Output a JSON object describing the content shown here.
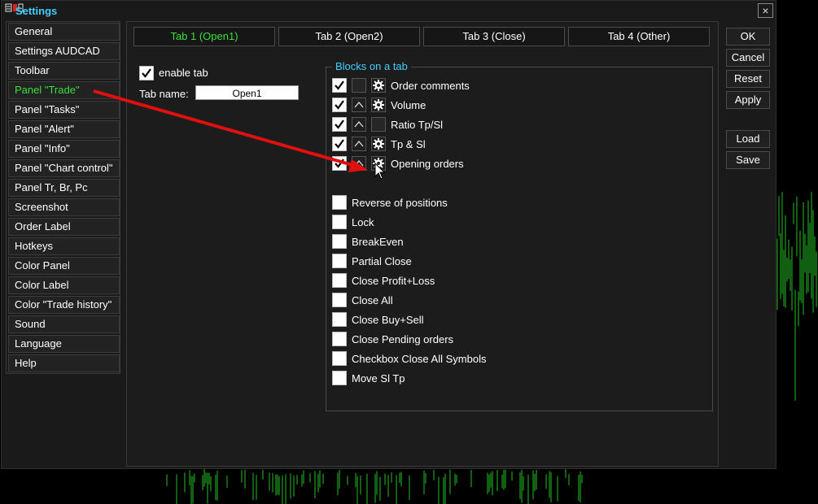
{
  "window": {
    "title": "Settings",
    "close_symbol": "×"
  },
  "sidebar": {
    "items": [
      {
        "label": "General",
        "active": false
      },
      {
        "label": "Settings AUDCAD",
        "active": false
      },
      {
        "label": "Toolbar",
        "active": false
      },
      {
        "label": "Panel \"Trade\"",
        "active": true
      },
      {
        "label": "Panel \"Tasks\"",
        "active": false
      },
      {
        "label": "Panel \"Alert\"",
        "active": false
      },
      {
        "label": "Panel \"Info\"",
        "active": false
      },
      {
        "label": "Panel \"Chart control\"",
        "active": false
      },
      {
        "label": "Panel Tr, Br, Pc",
        "active": false
      },
      {
        "label": "Screenshot",
        "active": false
      },
      {
        "label": "Order Label",
        "active": false
      },
      {
        "label": "Hotkeys",
        "active": false
      },
      {
        "label": "Color Panel",
        "active": false
      },
      {
        "label": "Color Label",
        "active": false
      },
      {
        "label": "Color \"Trade history\"",
        "active": false
      },
      {
        "label": "Sound",
        "active": false
      },
      {
        "label": "Language",
        "active": false
      },
      {
        "label": "Help",
        "active": false
      }
    ]
  },
  "tabs": [
    {
      "label": "Tab 1 (Open1)",
      "active": true
    },
    {
      "label": "Tab 2 (Open2)",
      "active": false
    },
    {
      "label": "Tab 3 (Close)",
      "active": false
    },
    {
      "label": "Tab 4 (Other)",
      "active": false
    }
  ],
  "tab_settings": {
    "enable_label": "enable tab",
    "enable_checked": true,
    "name_label": "Tab name:",
    "name_value": "Open1"
  },
  "blocks": {
    "legend": "Blocks on a tab",
    "items": [
      {
        "label": "Order comments",
        "checked": true,
        "up_arrow": false,
        "gear": true
      },
      {
        "label": "Volume",
        "checked": true,
        "up_arrow": true,
        "gear": true
      },
      {
        "label": "Ratio Tp/Sl",
        "checked": true,
        "up_arrow": true,
        "gear": false
      },
      {
        "label": "Tp & Sl",
        "checked": true,
        "up_arrow": true,
        "gear": true
      },
      {
        "label": "Opening orders",
        "checked": true,
        "up_arrow": true,
        "gear": true
      }
    ]
  },
  "options": [
    {
      "label": "Reverse of positions",
      "checked": false
    },
    {
      "label": "Lock",
      "checked": false
    },
    {
      "label": "BreakEven",
      "checked": false
    },
    {
      "label": "Partial Close",
      "checked": false
    },
    {
      "label": "Close Profit+Loss",
      "checked": false
    },
    {
      "label": "Close All",
      "checked": false
    },
    {
      "label": "Close Buy+Sell",
      "checked": false
    },
    {
      "label": "Close Pending orders",
      "checked": false
    },
    {
      "label": "Checkbox Close All Symbols",
      "checked": false
    },
    {
      "label": "Move Sl Tp",
      "checked": false
    }
  ],
  "buttons": {
    "ok": "OK",
    "cancel": "Cancel",
    "reset": "Reset",
    "apply": "Apply",
    "load": "Load",
    "save": "Save"
  },
  "colors": {
    "accent_green": "#38e038",
    "title_blue": "#3fd0ff",
    "annotation_arrow": "#e01010",
    "chart_candles": "#22c022"
  },
  "annotation": {
    "arrow_icon": "red-annotation-arrow-icon",
    "cursor_icon": "mouse-cursor-icon"
  }
}
